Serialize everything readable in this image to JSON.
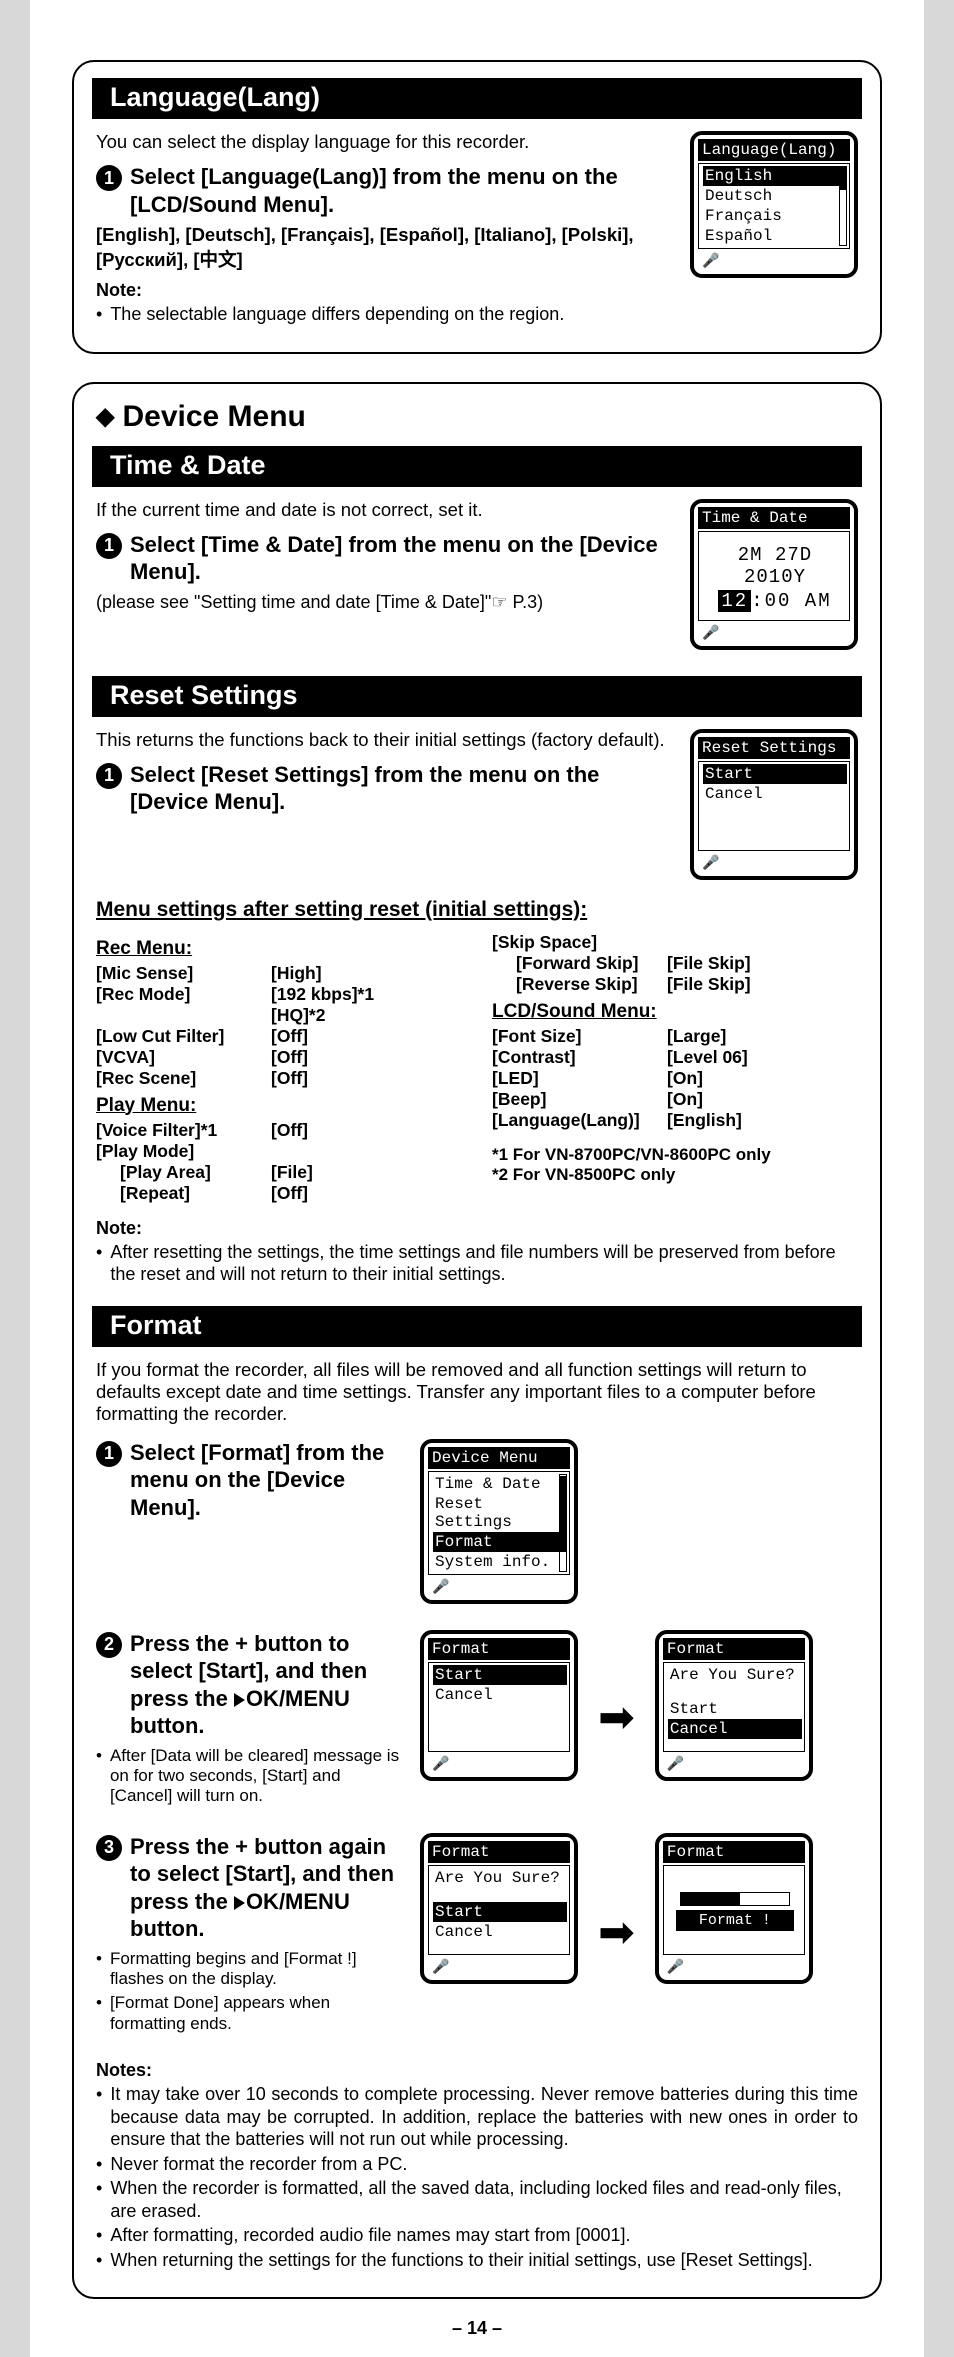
{
  "lang": {
    "header": "Language(Lang)",
    "intro": "You can select the display language for this recorder.",
    "step1": "Select [Language(Lang)] from the menu on the [LCD/Sound Menu].",
    "options": "[English], [Deutsch], [Français], [Español], [Italiano], [Polski], [Русский], [中文]",
    "noteLabel": "Note:",
    "note1": "The selectable language differs depending on the region.",
    "lcdTitle": "Language(Lang)",
    "lcdItems": [
      "English",
      "Deutsch",
      "Français",
      "Español"
    ]
  },
  "deviceMenu": {
    "heading": "Device Menu"
  },
  "timeDate": {
    "header": "Time & Date",
    "intro": "If the current time and date is not correct, set it.",
    "step1": "Select [Time & Date] from the menu on the [Device Menu].",
    "ref": "(please see \"Setting time and date [Time & Date]\"☞ P.3)",
    "lcdTitle": "Time & Date",
    "dateLine": "2M 27D 2010Y",
    "hour": "12",
    "timeRest": ":00 AM"
  },
  "reset": {
    "header": "Reset Settings",
    "intro": "This returns the functions back to their initial settings (factory default).",
    "step1": "Select [Reset Settings] from the menu on the [Device Menu].",
    "lcdTitle": "Reset Settings",
    "lcdItems": [
      "Start",
      "Cancel"
    ],
    "afterHeading": "Menu settings after setting reset (initial settings):",
    "rec": {
      "title": "Rec Menu:",
      "micSense": "[Mic Sense]",
      "micSenseV": "[High]",
      "recMode": "[Rec Mode]",
      "recModeV1": "[192 kbps]*1",
      "recModeV2": "[HQ]*2",
      "lowCut": "[Low Cut Filter]",
      "lowCutV": "[Off]",
      "vcva": "[VCVA]",
      "vcvaV": "[Off]",
      "recScene": "[Rec Scene]",
      "recSceneV": "[Off]"
    },
    "play": {
      "title": "Play Menu:",
      "voiceFilter": "[Voice Filter]*1",
      "voiceFilterV": "[Off]",
      "playMode": "[Play Mode]",
      "playArea": "[Play Area]",
      "playAreaV": "[File]",
      "repeat": "[Repeat]",
      "repeatV": "[Off]"
    },
    "right": {
      "skipSpace": "[Skip Space]",
      "fwd": "[Forward Skip]",
      "fwdV": "[File Skip]",
      "rev": "[Reverse Skip]",
      "revV": "[File Skip]",
      "lcdTitle": "LCD/Sound Menu:",
      "fontSize": "[Font Size]",
      "fontSizeV": "[Large]",
      "contrast": "[Contrast]",
      "contrastV": "[Level 06]",
      "led": "[LED]",
      "ledV": "[On]",
      "beep": "[Beep]",
      "beepV": "[On]",
      "langK": "[Language(Lang)]",
      "langV": "[English]"
    },
    "fn1": "*1  For VN-8700PC/VN-8600PC only",
    "fn2": "*2  For VN-8500PC only",
    "noteLabel": "Note:",
    "note1": "After resetting the settings, the time settings and file numbers will be preserved from before the reset and will not return to their initial settings."
  },
  "format": {
    "header": "Format",
    "intro": "If you format the recorder, all files will be removed and all function settings will return to defaults except date and time settings. Transfer any important files to a computer before formatting the recorder.",
    "step1": "Select [Format] from the menu on the [Device Menu].",
    "step2a": "Press the + button to select [Start], and then press the ",
    "step2b": "OK/MENU button.",
    "step2sub": "After [Data will be cleared] message is on for two seconds, [Start] and [Cancel] will turn on.",
    "step3a": "Press the + button again to select [Start], and then press the ",
    "step3b": "OK/MENU button.",
    "step3sub1": "Formatting begins and [Format !] flashes on the display.",
    "step3sub2": "[Format Done] appears when formatting ends.",
    "lcdMenu": {
      "title": "Device Menu",
      "items": [
        "Time & Date",
        "Reset Settings",
        "Format",
        "System info."
      ]
    },
    "lcdFmt1": {
      "title": "Format",
      "items": [
        "Start",
        "Cancel"
      ]
    },
    "lcdFmt2": {
      "title": "Format",
      "q": "Are You Sure?",
      "items": [
        "Start",
        "Cancel"
      ]
    },
    "lcdFmt3": {
      "title": "Format",
      "q": "Are You Sure?",
      "items": [
        "Start",
        "Cancel"
      ]
    },
    "lcdFmt4": {
      "title": "Format",
      "msg": "Format !"
    },
    "notesLabel": "Notes:",
    "n1": "It may take over 10 seconds to complete processing. Never remove batteries during this time because data may be corrupted. In addition, replace the batteries with new ones in order to ensure that the batteries will not run out while processing.",
    "n2": "Never format the recorder from a PC.",
    "n3": "When the recorder is formatted, all the saved data, including locked files and read-only files, are erased.",
    "n4": "After formatting, recorded audio file names may start from [0001].",
    "n5": "When returning the settings for the functions to their initial settings, use [Reset Settings]."
  },
  "pageNumber": "– 14 –",
  "micIcon": "🎤"
}
